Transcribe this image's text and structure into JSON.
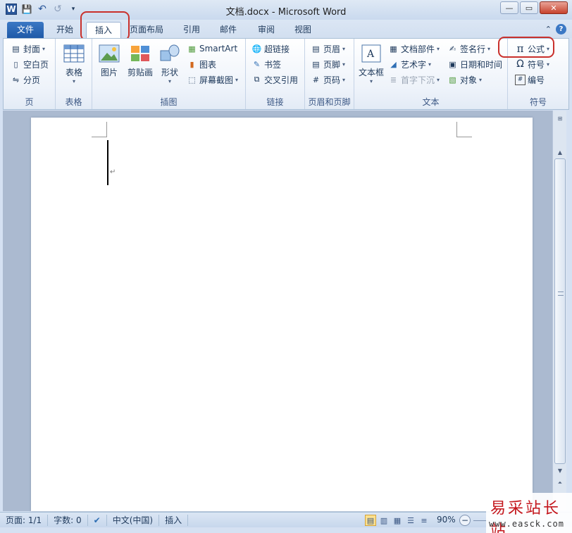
{
  "window": {
    "title": "文档.docx - Microsoft Word",
    "app_icon": "W",
    "minimize": "—",
    "maximize": "▭",
    "close": "✕"
  },
  "qat": {
    "save": "💾",
    "undo": "↶",
    "redo": "↺",
    "customize": "▾"
  },
  "tabs": {
    "file": "文件",
    "items": [
      "开始",
      "插入",
      "页面布局",
      "引用",
      "邮件",
      "审阅",
      "视图"
    ],
    "active": "插入",
    "minimize_ribbon": "⌃",
    "help": "?"
  },
  "ribbon": {
    "pages": {
      "label": "页",
      "cover": "封面",
      "blank": "空白页",
      "break": "分页"
    },
    "tables": {
      "label": "表格",
      "table": "表格"
    },
    "illustrations": {
      "label": "插图",
      "picture": "图片",
      "clipart": "剪贴画",
      "shapes": "形状",
      "smartart": "SmartArt",
      "chart": "图表",
      "screenshot": "屏幕截图"
    },
    "links": {
      "label": "链接",
      "hyperlink": "超链接",
      "bookmark": "书签",
      "crossref": "交叉引用"
    },
    "header_footer": {
      "label": "页眉和页脚",
      "header": "页眉",
      "footer": "页脚",
      "page_number": "页码"
    },
    "text": {
      "label": "文本",
      "textbox": "文本框",
      "quickparts": "文档部件",
      "wordart": "艺术字",
      "dropcap": "首字下沉",
      "signature": "签名行",
      "datetime": "日期和时间",
      "object": "对象"
    },
    "symbols": {
      "label": "符号",
      "equation": "公式",
      "symbol": "符号",
      "number": "编号"
    }
  },
  "status": {
    "page": "页面: 1/1",
    "words": "字数: 0",
    "language": "中文(中国)",
    "mode": "插入",
    "zoom": "90%",
    "zoom_minus": "−"
  },
  "watermark": {
    "logo": "易采站长站",
    "url": "www.easck.com"
  },
  "colors": {
    "file_tab": "#2b62b0",
    "highlight": "#c9302c",
    "ribbon_bg": "#eef3fa"
  }
}
